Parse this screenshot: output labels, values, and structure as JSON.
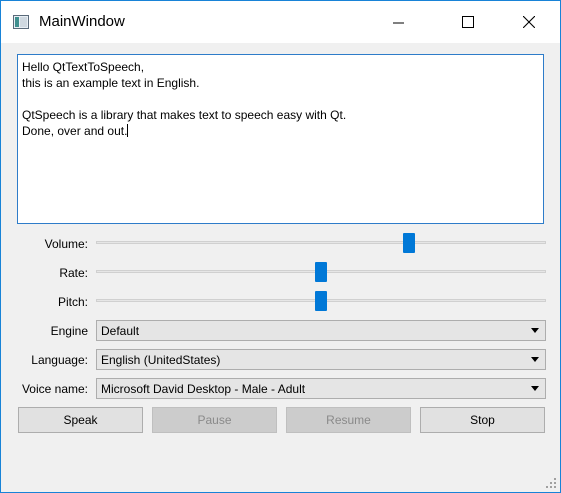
{
  "window": {
    "title": "MainWindow",
    "controls": {
      "minimize": "minimize-icon",
      "maximize": "maximize-icon",
      "close": "close-icon"
    }
  },
  "editor": {
    "lines": [
      "Hello QtTextToSpeech,",
      "this is an example text in English.",
      "",
      "QtSpeech is a library that makes text to speech easy with Qt.",
      "Done, over and out."
    ]
  },
  "sliders": {
    "volume": {
      "label": "Volume:",
      "value": 0.7
    },
    "rate": {
      "label": "Rate:",
      "value": 0.5
    },
    "pitch": {
      "label": "Pitch:",
      "value": 0.5
    }
  },
  "combos": {
    "engine": {
      "label": "Engine",
      "value": "Default"
    },
    "language": {
      "label": "Language:",
      "value": "English (UnitedStates)"
    },
    "voice": {
      "label": "Voice name:",
      "value": "Microsoft David Desktop - Male - Adult"
    }
  },
  "buttons": {
    "speak": {
      "label": "Speak",
      "enabled": true
    },
    "pause": {
      "label": "Pause",
      "enabled": false
    },
    "resume": {
      "label": "Resume",
      "enabled": false
    },
    "stop": {
      "label": "Stop",
      "enabled": true
    }
  },
  "colors": {
    "accent": "#0078d7",
    "window_border": "#1883d7",
    "background": "#f0f0f0"
  }
}
